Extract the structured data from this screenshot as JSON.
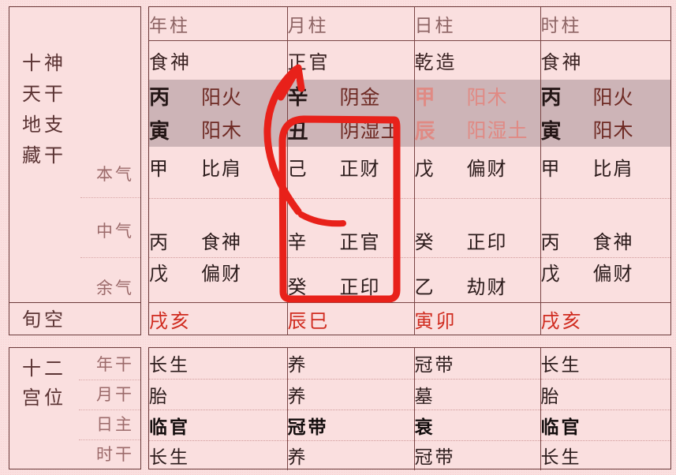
{
  "chart": {
    "title_row_labels": [
      "年柱",
      "月柱",
      "日柱",
      "时柱"
    ],
    "side_labels": {
      "ten_gods": "十神",
      "heavenly_stem": "天干",
      "earthly_branch": "地支",
      "hidden_stems": "藏干",
      "hidden_sub": [
        "本气",
        "中气",
        "余气"
      ],
      "xunkong": "旬空",
      "palace_title_line1": "十二",
      "palace_title_line2": "宫位",
      "palace_sub": [
        "年干",
        "月干",
        "日主",
        "时干"
      ]
    },
    "pillars": [
      {
        "name": "年柱",
        "ten_god": "食神",
        "stem": "丙",
        "stem_element": "阳火",
        "branch": "寅",
        "branch_element": "阳木",
        "stem_red": false,
        "hidden": {
          "benqi": {
            "stem": "甲",
            "god": "比肩"
          },
          "zhongqi": {
            "stem": "丙",
            "god": "食神"
          },
          "yuqi": {
            "stem": "戊",
            "god": "偏财"
          }
        },
        "xunkong": "戌亥",
        "palace": [
          "长生",
          "胎",
          "临官",
          "长生"
        ],
        "palace_strong": [
          false,
          false,
          true,
          false
        ]
      },
      {
        "name": "月柱",
        "ten_god": "正官",
        "stem": "辛",
        "stem_element": "阴金",
        "branch": "丑",
        "branch_element": "阴湿土",
        "stem_red": false,
        "hidden": {
          "benqi": {
            "stem": "己",
            "god": "正财"
          },
          "zhongqi": {
            "stem": "辛",
            "god": "正官"
          },
          "yuqi": {
            "stem": "癸",
            "god": "正印"
          }
        },
        "xunkong": "辰巳",
        "palace": [
          "养",
          "养",
          "冠带",
          "养"
        ],
        "palace_strong": [
          false,
          false,
          true,
          false
        ]
      },
      {
        "name": "日柱",
        "ten_god": "乾造",
        "stem": "甲",
        "stem_element": "阳木",
        "branch": "辰",
        "branch_element": "阳湿土",
        "stem_red": true,
        "hidden": {
          "benqi": {
            "stem": "戊",
            "god": "偏财"
          },
          "zhongqi": {
            "stem": "癸",
            "god": "正印"
          },
          "yuqi": {
            "stem": "乙",
            "god": "劫财"
          }
        },
        "xunkong": "寅卯",
        "palace": [
          "冠带",
          "墓",
          "衰",
          "冠带"
        ],
        "palace_strong": [
          false,
          false,
          true,
          false
        ]
      },
      {
        "name": "时柱",
        "ten_god": "食神",
        "stem": "丙",
        "stem_element": "阳火",
        "branch": "寅",
        "branch_element": "阳木",
        "stem_red": false,
        "hidden": {
          "benqi": {
            "stem": "甲",
            "god": "比肩"
          },
          "zhongqi": {
            "stem": "丙",
            "god": "食神"
          },
          "yuqi": {
            "stem": "戊",
            "god": "偏财"
          }
        },
        "xunkong": "戌亥",
        "palace": [
          "长生",
          "胎",
          "临官",
          "长生"
        ],
        "palace_strong": [
          false,
          false,
          true,
          false
        ]
      }
    ],
    "annotation": {
      "color": "#e8211a",
      "shape": "box-around-month-hidden-stems-with-arrow-to-month-ten-god"
    },
    "colors": {
      "background": "#fadfdf",
      "gz_band": "#cdb4b7",
      "border": "#6b3a3a",
      "red_text": "#d02b1f",
      "element_text": "#6e2a24",
      "day_master_red": "#e08a84"
    }
  }
}
